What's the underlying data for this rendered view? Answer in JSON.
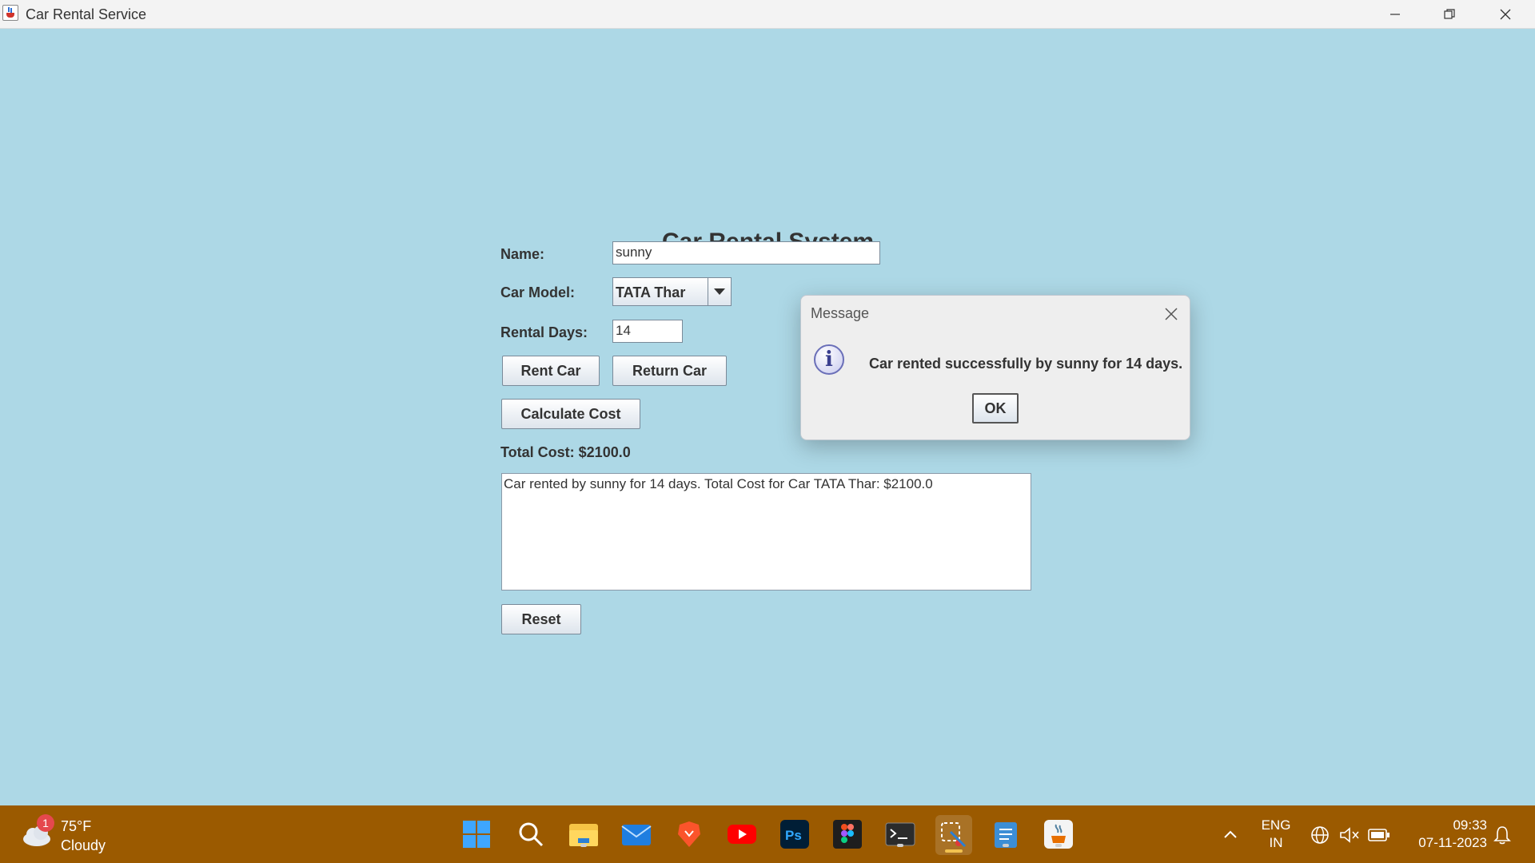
{
  "window": {
    "title": "Car Rental Service"
  },
  "form": {
    "heading": "Car Rental System",
    "name_label": "Name:",
    "name_value": "sunny",
    "car_model_label": "Car Model:",
    "car_model_value": "TATA Thar",
    "rental_days_label": "Rental Days:",
    "rental_days_value": "14",
    "rent_button": "Rent Car",
    "return_button": "Return Car",
    "calculate_button": "Calculate Cost",
    "total_cost": "Total Cost: $2100.0",
    "log_text": "Car rented by sunny for 14 days. Total Cost for Car TATA Thar: $2100.0",
    "reset_button": "Reset"
  },
  "dialog": {
    "title": "Message",
    "message": "Car rented successfully by sunny for 14 days.",
    "ok_button": "OK"
  },
  "taskbar": {
    "weather_temp": "75°F",
    "weather_desc": "Cloudy",
    "weather_badge": "1",
    "lang_top": "ENG",
    "lang_bottom": "IN",
    "time": "09:33",
    "date": "07-11-2023",
    "apps": [
      "start-icon",
      "search-icon",
      "file-explorer-icon",
      "mail-icon",
      "brave-icon",
      "youtube-icon",
      "photoshop-icon",
      "figma-icon",
      "terminal-icon",
      "snipping-tool-icon",
      "notepad-icon",
      "java-icon"
    ]
  },
  "colors": {
    "window_background": "#add8e6",
    "taskbar_background": "#9b5a00"
  }
}
